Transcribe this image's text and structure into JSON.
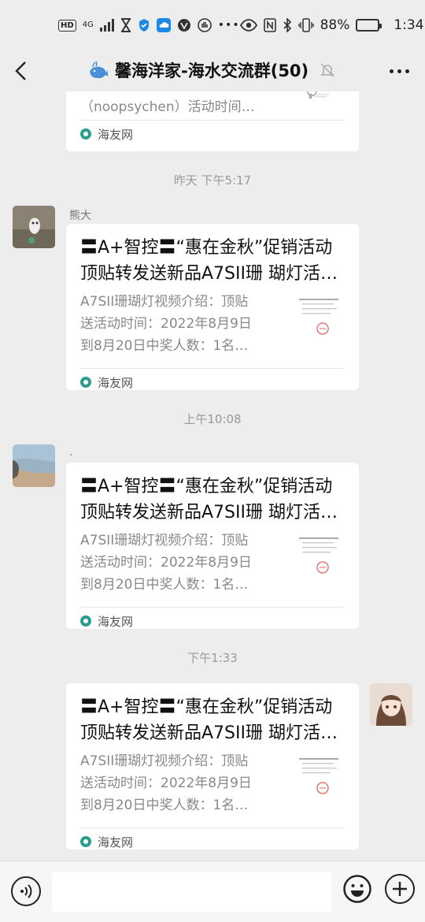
{
  "status_bar": {
    "hd": "HD",
    "network": "4G",
    "battery_percent": "88%",
    "battery_level": 0.88,
    "time": "1:34"
  },
  "nav": {
    "back_icon": "chevron-left-icon",
    "title": "馨海洋家-海水交流群(50)",
    "muted_icon": "bell-off-icon",
    "more_icon": "more-dots-icon"
  },
  "messages": [
    {
      "kind": "partial-card",
      "desc": "（noopsychen）活动时间…",
      "source": "海友网"
    },
    {
      "kind": "timestamp",
      "text": "昨天 下午5:17"
    },
    {
      "kind": "card",
      "side": "left",
      "sender": "熊大",
      "title": "〓A+智控〓“惠在金秋”促销活动",
      "title2": "顶贴转发送新品A7SII珊 瑚灯活…",
      "desc": "A7SII珊瑚灯视频介绍：顶贴\n送活动时间：2022年8月9日\n到8月20日中奖人数：1名…",
      "source": "海友网"
    },
    {
      "kind": "timestamp",
      "text": "上午10:08"
    },
    {
      "kind": "card",
      "side": "left",
      "sender": ".",
      "title": "〓A+智控〓“惠在金秋”促销活动",
      "title2": "顶贴转发送新品A7SII珊 瑚灯活…",
      "desc": "A7SII珊瑚灯视频介绍：顶贴\n送活动时间：2022年8月9日\n到8月20日中奖人数：1名…",
      "source": "海友网"
    },
    {
      "kind": "timestamp",
      "text": "下午1:33"
    },
    {
      "kind": "card",
      "side": "right",
      "title": "〓A+智控〓“惠在金秋”促销活动",
      "title2": "顶贴转发送新品A7SII珊 瑚灯活…",
      "desc": "A7SII珊瑚灯视频介绍：顶贴\n送活动时间：2022年8月9日\n到8月20日中奖人数：1名…",
      "source": "海友网"
    }
  ],
  "input_bar": {
    "voice_icon": "voice-icon",
    "input_value": "",
    "emoji_icon": "emoji-icon",
    "plus_icon": "plus-circle-icon"
  }
}
